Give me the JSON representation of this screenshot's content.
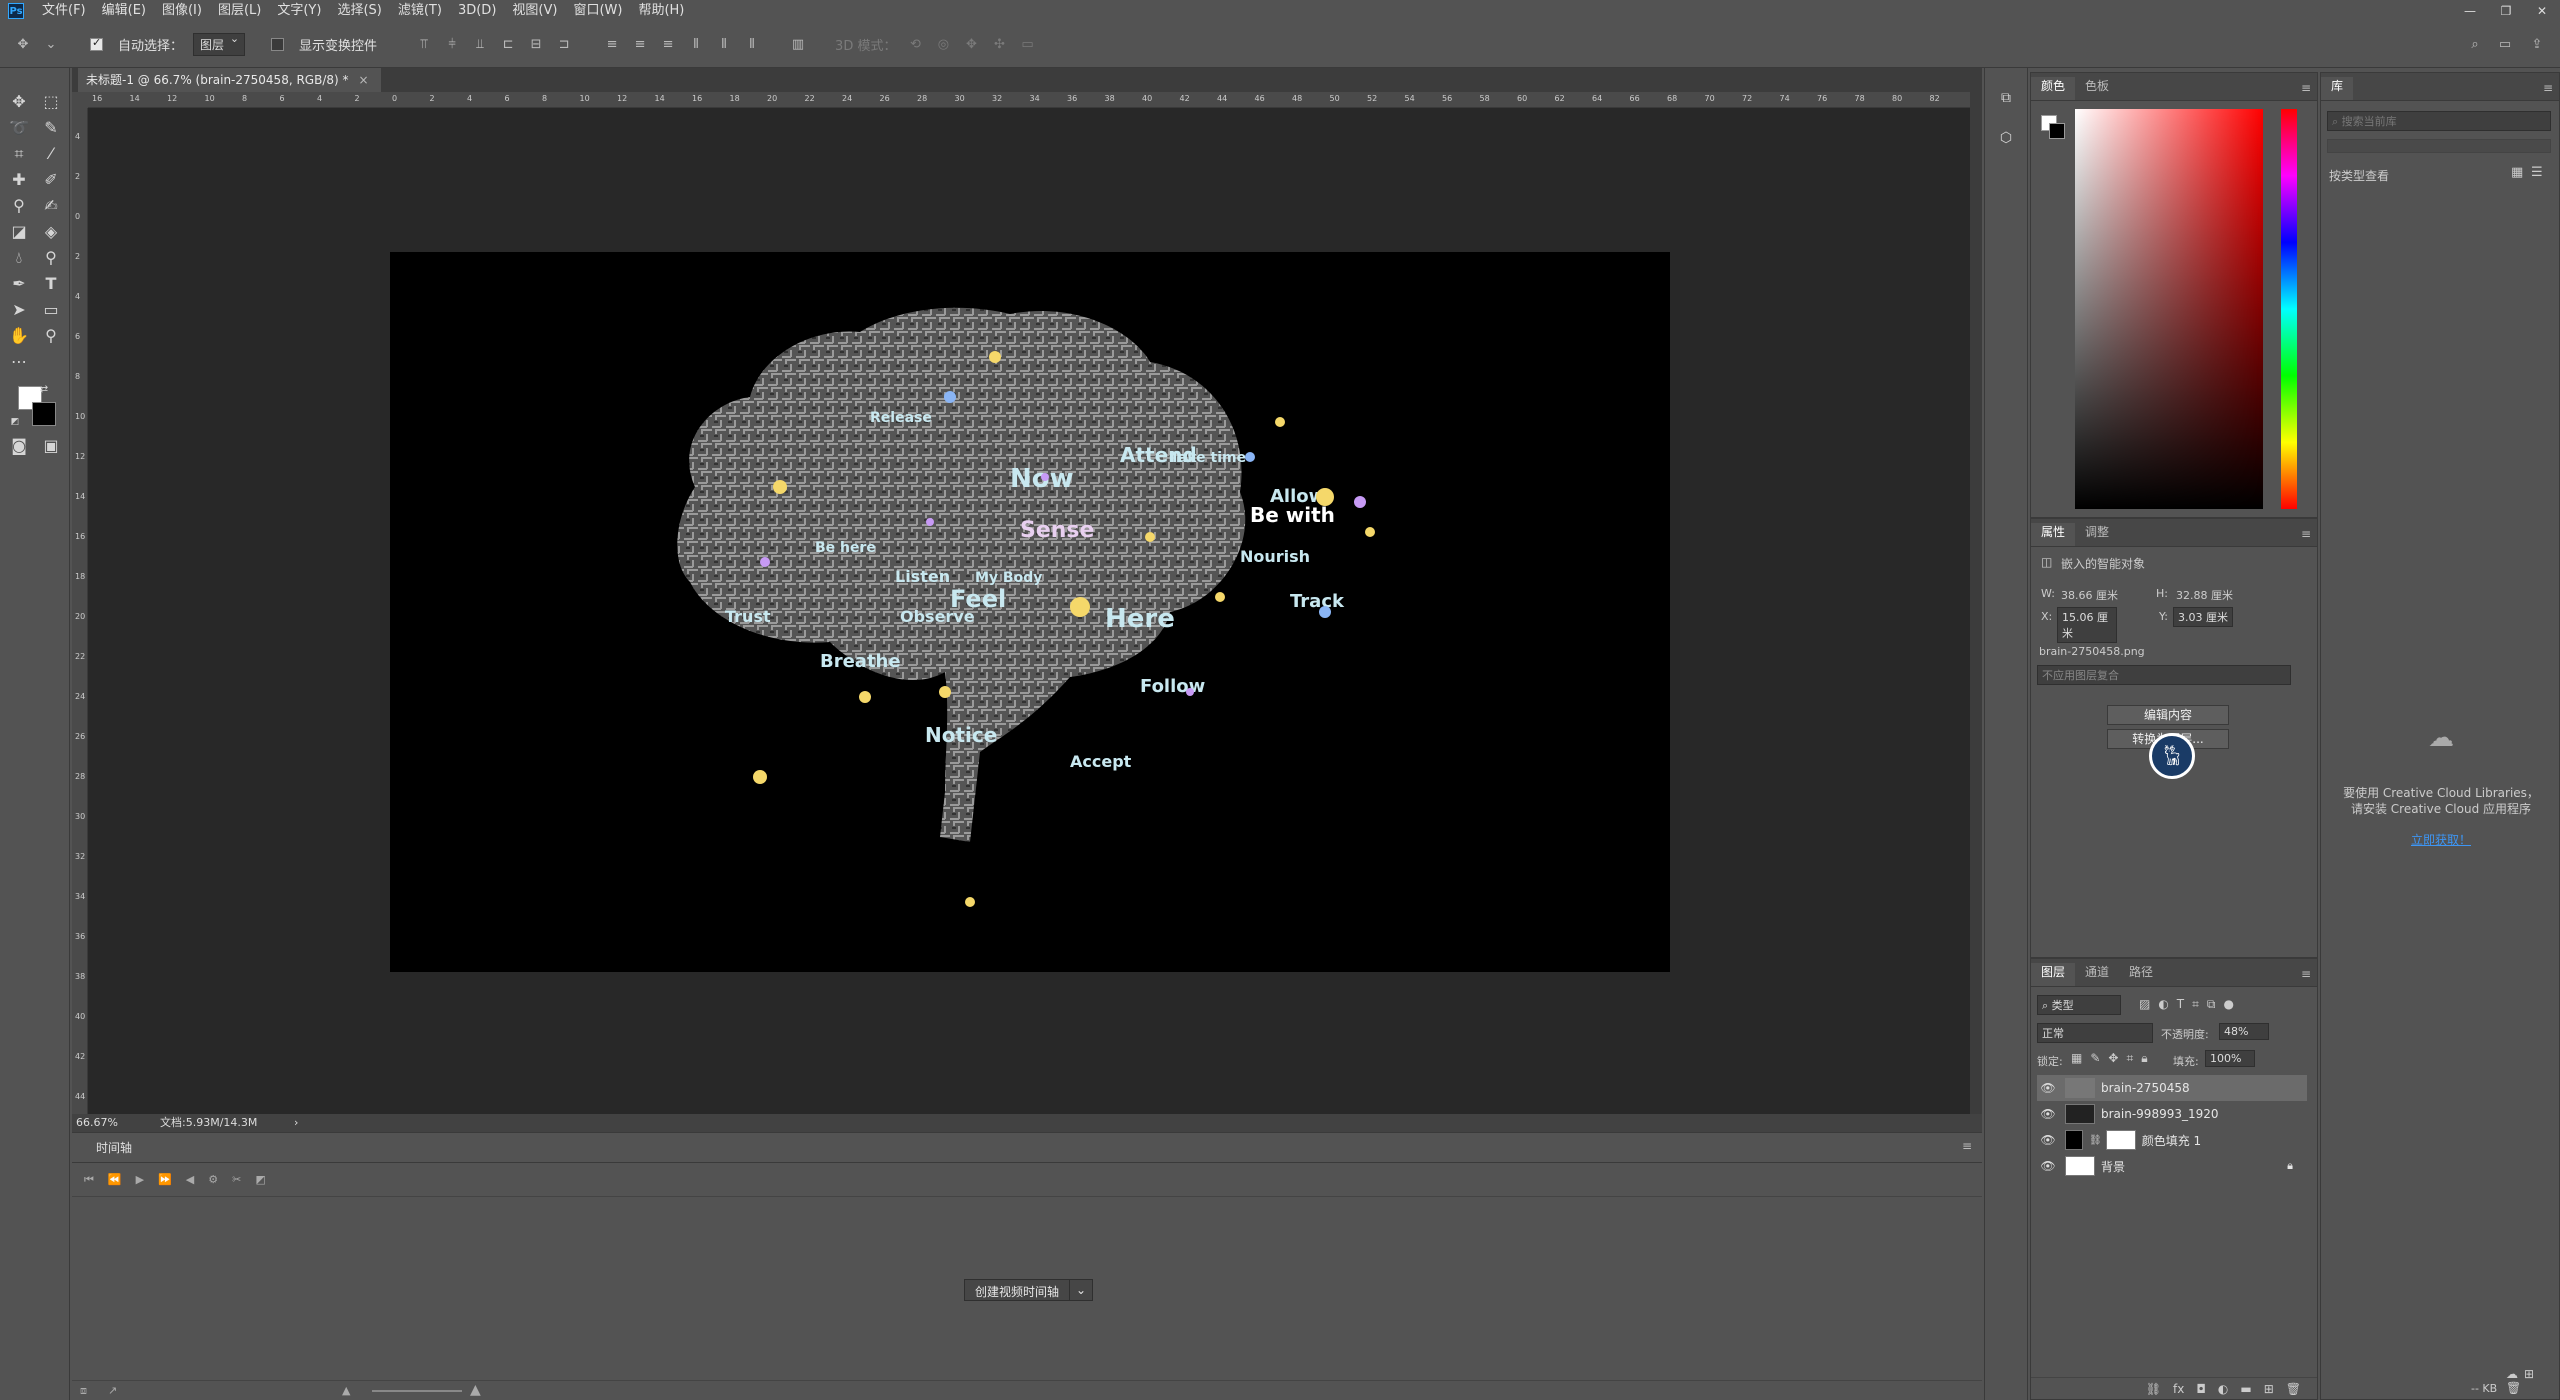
{
  "app": {
    "logo": "Ps"
  },
  "menu": [
    "文件(F)",
    "编辑(E)",
    "图像(I)",
    "图层(L)",
    "文字(Y)",
    "选择(S)",
    "滤镜(T)",
    "3D(D)",
    "视图(V)",
    "窗口(W)",
    "帮助(H)"
  ],
  "window_controls": [
    "—",
    "❐",
    "✕"
  ],
  "options": {
    "auto_select_label": "自动选择：",
    "auto_select_value": "图层",
    "show_transform_label": "显示变换控件",
    "mode3d_label": "3D 模式："
  },
  "document": {
    "tab_title": "未标题-1 @ 66.7% (brain-2750458, RGB/8) *",
    "close": "×",
    "zoom": "66.67%",
    "doc_info": "文档:5.93M/14.3M",
    "words": [
      "Now",
      "Here",
      "Feel",
      "Sense",
      "Attend",
      "Allow",
      "Be with",
      "Notice",
      "Breathe",
      "Listen",
      "Follow",
      "Observe",
      "Accept",
      "Nourish",
      "Track",
      "My Body",
      "Trust",
      "Take time",
      "Be here",
      "Release"
    ]
  },
  "ruler_h": [
    "16",
    "14",
    "12",
    "10",
    "8",
    "6",
    "4",
    "2",
    "0",
    "2",
    "4",
    "6",
    "8",
    "10",
    "12",
    "14",
    "16",
    "18",
    "20",
    "22",
    "24",
    "26",
    "28",
    "30",
    "32",
    "34",
    "36",
    "38",
    "40",
    "42",
    "44",
    "46",
    "48",
    "50",
    "52",
    "54",
    "56",
    "58",
    "60",
    "62",
    "64",
    "66",
    "68",
    "70",
    "72",
    "74",
    "76",
    "78",
    "80",
    "82"
  ],
  "ruler_v": [
    "4",
    "2",
    "0",
    "2",
    "4",
    "6",
    "8",
    "10",
    "12",
    "14",
    "16",
    "18",
    "20",
    "22",
    "24",
    "26",
    "28",
    "30",
    "32",
    "34",
    "36",
    "38",
    "40",
    "42",
    "44"
  ],
  "timeline": {
    "tab": "时间轴",
    "create_button": "创建视频时间轴",
    "dropdown": "⌄"
  },
  "color_panel": {
    "tabs": [
      "颜色",
      "色板"
    ]
  },
  "properties": {
    "tabs": [
      "属性",
      "调整"
    ],
    "type": "嵌入的智能对象",
    "w_label": "W:",
    "w_value": "38.66 厘米",
    "h_label": "H:",
    "h_value": "32.88 厘米",
    "x_label": "X:",
    "x_value": "15.06 厘米",
    "y_label": "Y:",
    "y_value": "3.03 厘米",
    "filename": "brain-2750458.png",
    "comp_placeholder": "不应用图层复合",
    "edit_button": "编辑内容",
    "convert_button": "转换为图层..."
  },
  "layers": {
    "tabs": [
      "图层",
      "通道",
      "路径"
    ],
    "filter_label": "类型",
    "blend_mode": "正常",
    "opacity_label": "不透明度:",
    "opacity_value": "48%",
    "lock_label": "锁定:",
    "fill_label": "填充:",
    "fill_value": "100%",
    "items": [
      {
        "name": "brain-2750458"
      },
      {
        "name": "brain-998993_1920"
      },
      {
        "name": "颜色填充 1"
      },
      {
        "name": "背景"
      }
    ],
    "footer_icons": [
      "link-icon",
      "fx-icon",
      "mask-icon",
      "adjust-icon",
      "folder-icon",
      "new-layer-icon",
      "trash-icon"
    ]
  },
  "library": {
    "tab": "库",
    "search_placeholder": "搜索当前库",
    "view_label": "按类型查看",
    "message_line1": "要使用 Creative Cloud Libraries，",
    "message_line2": "请安装 Creative Cloud 应用程序",
    "install_link": "立即获取！",
    "footer": "-- KB"
  },
  "colors": {
    "accent": "#31a8ff",
    "link": "#3d96f5"
  }
}
